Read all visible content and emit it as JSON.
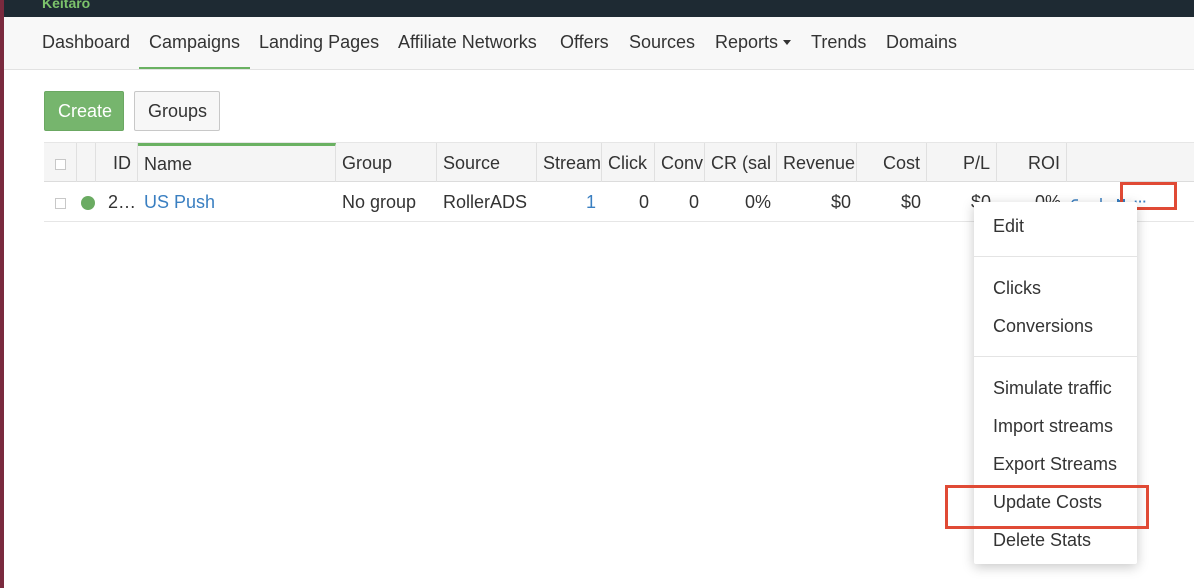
{
  "app": {
    "brand": "Keitaro"
  },
  "nav": {
    "items": [
      "Dashboard",
      "Campaigns",
      "Landing Pages",
      "Affiliate Networks",
      "Offers",
      "Sources",
      "Reports",
      "Trends",
      "Domains"
    ],
    "active": "Campaigns"
  },
  "toolbar": {
    "create_label": "Create",
    "groups_label": "Groups"
  },
  "table": {
    "columns": [
      "ID",
      "Name",
      "Group",
      "Source",
      "Stream",
      "Click",
      "Conv",
      "CR (sal",
      "Revenue",
      "Cost",
      "P/L",
      "ROI"
    ],
    "rows": [
      {
        "status_color": "#6aab62",
        "id": "2…",
        "name": "US Push",
        "group": "No group",
        "source": "RollerADS",
        "streams": "1",
        "clicks": "0",
        "conversions": "0",
        "cr": "0%",
        "revenue": "$0",
        "cost": "$0",
        "pl": "$0",
        "roi": "0%"
      }
    ]
  },
  "row_actions": {
    "icons": [
      "link-icon",
      "chart-icon",
      "clipboard-icon",
      "more-icon"
    ],
    "more_label": "···"
  },
  "context_menu": {
    "items": [
      "Edit",
      "Clicks",
      "Conversions",
      "Simulate traffic",
      "Import streams",
      "Export Streams",
      "Update Costs",
      "Delete Stats"
    ]
  },
  "highlight_color": "#e04a35"
}
